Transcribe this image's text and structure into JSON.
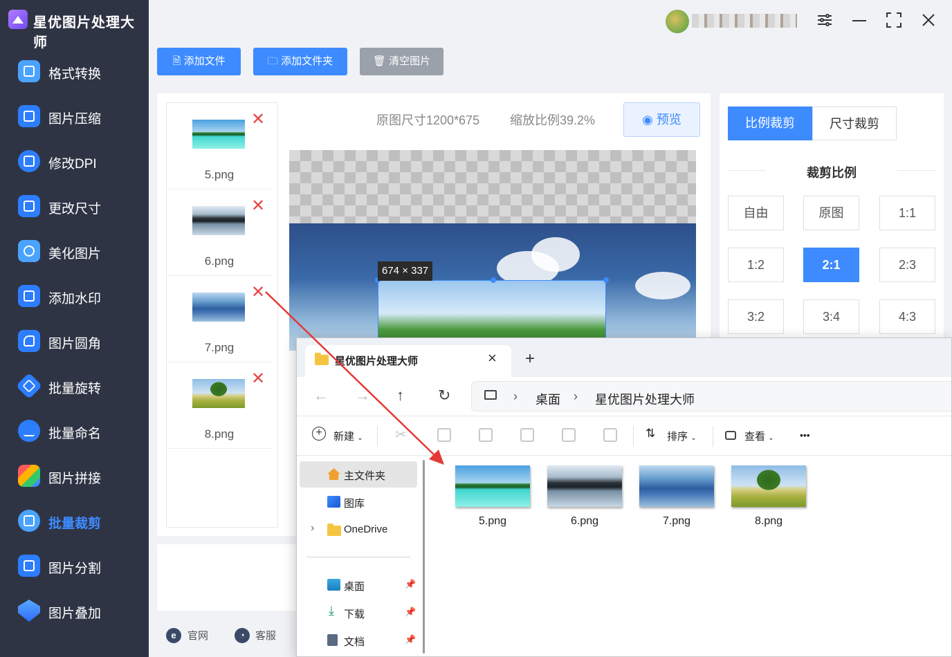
{
  "app": {
    "title": "星优图片处理大师"
  },
  "sidebar": {
    "items": [
      {
        "label": "格式转换",
        "icon": "format-convert-icon"
      },
      {
        "label": "图片压缩",
        "icon": "compress-icon"
      },
      {
        "label": "修改DPI",
        "icon": "dpi-icon"
      },
      {
        "label": "更改尺寸",
        "icon": "resize-icon"
      },
      {
        "label": "美化图片",
        "icon": "beautify-icon"
      },
      {
        "label": "添加水印",
        "icon": "watermark-icon"
      },
      {
        "label": "图片圆角",
        "icon": "round-corner-icon"
      },
      {
        "label": "批量旋转",
        "icon": "rotate-icon"
      },
      {
        "label": "批量命名",
        "icon": "rename-icon"
      },
      {
        "label": "图片拼接",
        "icon": "stitch-icon"
      },
      {
        "label": "批量裁剪",
        "icon": "crop-icon"
      },
      {
        "label": "图片分割",
        "icon": "split-icon"
      },
      {
        "label": "图片叠加",
        "icon": "overlay-icon"
      }
    ],
    "active_index": 10
  },
  "toolbar": {
    "add_file": "添加文件",
    "add_folder": "添加文件夹",
    "clear": "清空图片"
  },
  "file_list": [
    {
      "name": "5.png"
    },
    {
      "name": "6.png"
    },
    {
      "name": "7.png"
    },
    {
      "name": "8.png"
    }
  ],
  "preview": {
    "original_size": "原图尺寸1200*675",
    "zoom": "缩放比例39.2%",
    "preview_button": "预览",
    "crop_size": "674 × 337"
  },
  "crop": {
    "tab_ratio": "比例裁剪",
    "tab_size": "尺寸裁剪",
    "section_title": "裁剪比例",
    "ratios": [
      "自由",
      "原图",
      "1:1",
      "1:2",
      "2:1",
      "2:3",
      "3:2",
      "3:4",
      "4:3"
    ],
    "selected_ratio": "2:1"
  },
  "footer": {
    "website": "官网",
    "support": "客服"
  },
  "explorer": {
    "tab_title": "星优图片处理大师",
    "breadcrumb": [
      "桌面",
      "星优图片处理大师"
    ],
    "commands": {
      "new": "新建",
      "sort": "排序",
      "view": "查看",
      "more": "•••"
    },
    "nav": {
      "home": "主文件夹",
      "gallery": "图库",
      "onedrive": "OneDrive",
      "desktop": "桌面",
      "downloads": "下载",
      "documents": "文档"
    },
    "files": [
      {
        "name": "5.png"
      },
      {
        "name": "6.png"
      },
      {
        "name": "7.png"
      },
      {
        "name": "8.png"
      }
    ]
  },
  "colors": {
    "accent": "#3d8bff",
    "sidebar_bg": "#2f3445",
    "delete": "#e84545",
    "arrow": "#e53935"
  }
}
